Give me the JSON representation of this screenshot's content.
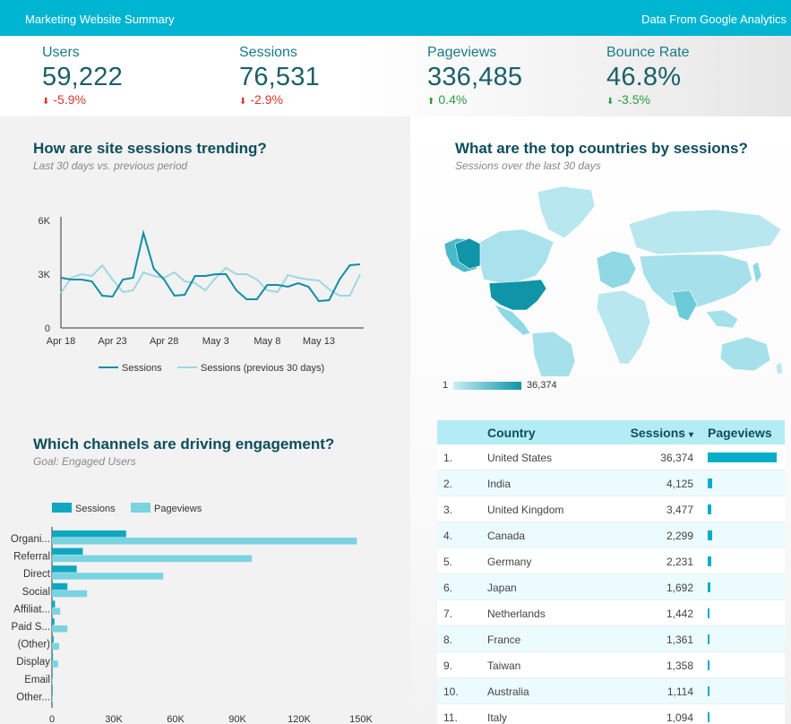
{
  "header": {
    "title": "Marketing Website Summary",
    "source": "Data From Google Analytics"
  },
  "kpis": [
    {
      "label": "Users",
      "value": "59,222",
      "change": "-5.9%",
      "direction": "down"
    },
    {
      "label": "Sessions",
      "value": "76,531",
      "change": "-2.9%",
      "direction": "down"
    },
    {
      "label": "Pageviews",
      "value": "336,485",
      "change": "0.4%",
      "direction": "up"
    },
    {
      "label": "Bounce Rate",
      "value": "46.8%",
      "change": "-3.5%",
      "direction": "down-good"
    }
  ],
  "colors": {
    "accent": "#00b5d1",
    "series_primary": "#0f8fa3",
    "series_secondary": "#9fd6e0",
    "bar_primary": "#0fa7bf",
    "bar_secondary": "#7ad3e0",
    "negative": "#d9342b",
    "positive": "#2c9d3d"
  },
  "trend": {
    "title": "How are site sessions trending?",
    "subtitle": "Last 30 days vs. previous period",
    "legend": [
      "Sessions",
      "Sessions (previous 30 days)"
    ]
  },
  "channels": {
    "title": "Which channels are driving engagement?",
    "subtitle": "Goal: Engaged Users",
    "legend": [
      "Sessions",
      "Pageviews"
    ]
  },
  "geo": {
    "title": "What are the top countries by sessions?",
    "subtitle": "Sessions over the last 30 days",
    "scale_min": "1",
    "scale_max": "36,374"
  },
  "table": {
    "headers": {
      "country": "Country",
      "sessions": "Sessions",
      "sort_icon": "▾",
      "pageviews": "Pageviews"
    },
    "rows": [
      {
        "idx": "1.",
        "country": "United States",
        "sessions": "36,374"
      },
      {
        "idx": "2.",
        "country": "India",
        "sessions": "4,125"
      },
      {
        "idx": "3.",
        "country": "United Kingdom",
        "sessions": "3,477"
      },
      {
        "idx": "4.",
        "country": "Canada",
        "sessions": "2,299"
      },
      {
        "idx": "5.",
        "country": "Germany",
        "sessions": "2,231"
      },
      {
        "idx": "6.",
        "country": "Japan",
        "sessions": "1,692"
      },
      {
        "idx": "7.",
        "country": "Netherlands",
        "sessions": "1,442"
      },
      {
        "idx": "8.",
        "country": "France",
        "sessions": "1,361"
      },
      {
        "idx": "9.",
        "country": "Taiwan",
        "sessions": "1,358"
      },
      {
        "idx": "10.",
        "country": "Australia",
        "sessions": "1,114"
      },
      {
        "idx": "11.",
        "country": "Italy",
        "sessions": "1,094"
      }
    ],
    "pageview_ratio": [
      1.0,
      0.07,
      0.05,
      0.06,
      0.05,
      0.04,
      0.03,
      0.03,
      0.03,
      0.02,
      0.02
    ]
  },
  "chart_data": [
    {
      "type": "line",
      "title": "",
      "x_labels": [
        "Apr 18",
        "Apr 23",
        "Apr 28",
        "May 3",
        "May 8",
        "May 13"
      ],
      "x_label_index": [
        0,
        5,
        10,
        15,
        20,
        25
      ],
      "y_ticks": [
        "0",
        "3K",
        "6K"
      ],
      "ylim": [
        0,
        6000
      ],
      "series": [
        {
          "name": "Sessions",
          "values": [
            2800,
            2700,
            2700,
            2600,
            1800,
            1750,
            2700,
            2800,
            5300,
            3300,
            2700,
            1800,
            1850,
            2900,
            2900,
            3000,
            3000,
            2100,
            1600,
            1600,
            2400,
            2400,
            2300,
            2500,
            2300,
            1500,
            1550,
            2700,
            3500,
            3550
          ]
        },
        {
          "name": "Sessions (previous 30 days)",
          "values": [
            1950,
            2800,
            3000,
            2900,
            3500,
            2700,
            2000,
            2100,
            3100,
            2900,
            2800,
            3100,
            2600,
            2500,
            2100,
            2800,
            3350,
            3000,
            3000,
            2700,
            2100,
            2000,
            2950,
            2800,
            2700,
            2650,
            2150,
            1800,
            1800,
            3000
          ]
        }
      ]
    },
    {
      "type": "bar",
      "orientation": "horizontal",
      "categories": [
        "Organi...",
        "Referral",
        "Direct",
        "Social",
        "Affiliat...",
        "Paid S...",
        "(Other)",
        "Display",
        "Email",
        "Other..."
      ],
      "x_ticks": [
        "0",
        "30K",
        "60K",
        "90K",
        "120K",
        "150K"
      ],
      "xlim": [
        0,
        150000
      ],
      "series": [
        {
          "name": "Sessions",
          "values": [
            36000,
            15000,
            12000,
            7500,
            1500,
            1200,
            800,
            500,
            150,
            80
          ]
        },
        {
          "name": "Pageviews",
          "values": [
            148000,
            97000,
            54000,
            17000,
            4000,
            7500,
            3500,
            3000,
            300,
            150
          ]
        }
      ]
    }
  ]
}
